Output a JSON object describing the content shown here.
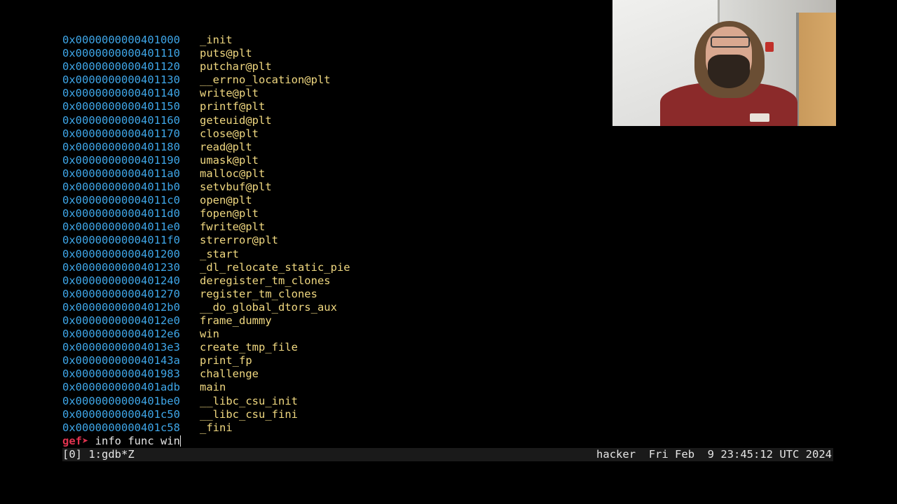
{
  "terminal": {
    "functions": [
      {
        "addr": "0x0000000000401000",
        "name": "_init"
      },
      {
        "addr": "0x0000000000401110",
        "name": "puts@plt"
      },
      {
        "addr": "0x0000000000401120",
        "name": "putchar@plt"
      },
      {
        "addr": "0x0000000000401130",
        "name": "__errno_location@plt"
      },
      {
        "addr": "0x0000000000401140",
        "name": "write@plt"
      },
      {
        "addr": "0x0000000000401150",
        "name": "printf@plt"
      },
      {
        "addr": "0x0000000000401160",
        "name": "geteuid@plt"
      },
      {
        "addr": "0x0000000000401170",
        "name": "close@plt"
      },
      {
        "addr": "0x0000000000401180",
        "name": "read@plt"
      },
      {
        "addr": "0x0000000000401190",
        "name": "umask@plt"
      },
      {
        "addr": "0x00000000004011a0",
        "name": "malloc@plt"
      },
      {
        "addr": "0x00000000004011b0",
        "name": "setvbuf@plt"
      },
      {
        "addr": "0x00000000004011c0",
        "name": "open@plt"
      },
      {
        "addr": "0x00000000004011d0",
        "name": "fopen@plt"
      },
      {
        "addr": "0x00000000004011e0",
        "name": "fwrite@plt"
      },
      {
        "addr": "0x00000000004011f0",
        "name": "strerror@plt"
      },
      {
        "addr": "0x0000000000401200",
        "name": "_start"
      },
      {
        "addr": "0x0000000000401230",
        "name": "_dl_relocate_static_pie"
      },
      {
        "addr": "0x0000000000401240",
        "name": "deregister_tm_clones"
      },
      {
        "addr": "0x0000000000401270",
        "name": "register_tm_clones"
      },
      {
        "addr": "0x00000000004012b0",
        "name": "__do_global_dtors_aux"
      },
      {
        "addr": "0x00000000004012e0",
        "name": "frame_dummy"
      },
      {
        "addr": "0x00000000004012e6",
        "name": "win"
      },
      {
        "addr": "0x00000000004013e3",
        "name": "create_tmp_file"
      },
      {
        "addr": "0x000000000040143a",
        "name": "print_fp"
      },
      {
        "addr": "0x0000000000401983",
        "name": "challenge"
      },
      {
        "addr": "0x0000000000401adb",
        "name": "main"
      },
      {
        "addr": "0x0000000000401be0",
        "name": "__libc_csu_init"
      },
      {
        "addr": "0x0000000000401c50",
        "name": "__libc_csu_fini"
      },
      {
        "addr": "0x0000000000401c58",
        "name": "_fini"
      }
    ],
    "prompt": "gef➤",
    "command": " info func win"
  },
  "statusbar": {
    "left": "[0] 1:gdb*Z",
    "right": "hacker  Fri Feb  9 23:45:12 UTC 2024"
  },
  "colors": {
    "address": "#3ea6e8",
    "symbol": "#f0d880",
    "prompt": "#e0334f",
    "background": "#000000"
  }
}
